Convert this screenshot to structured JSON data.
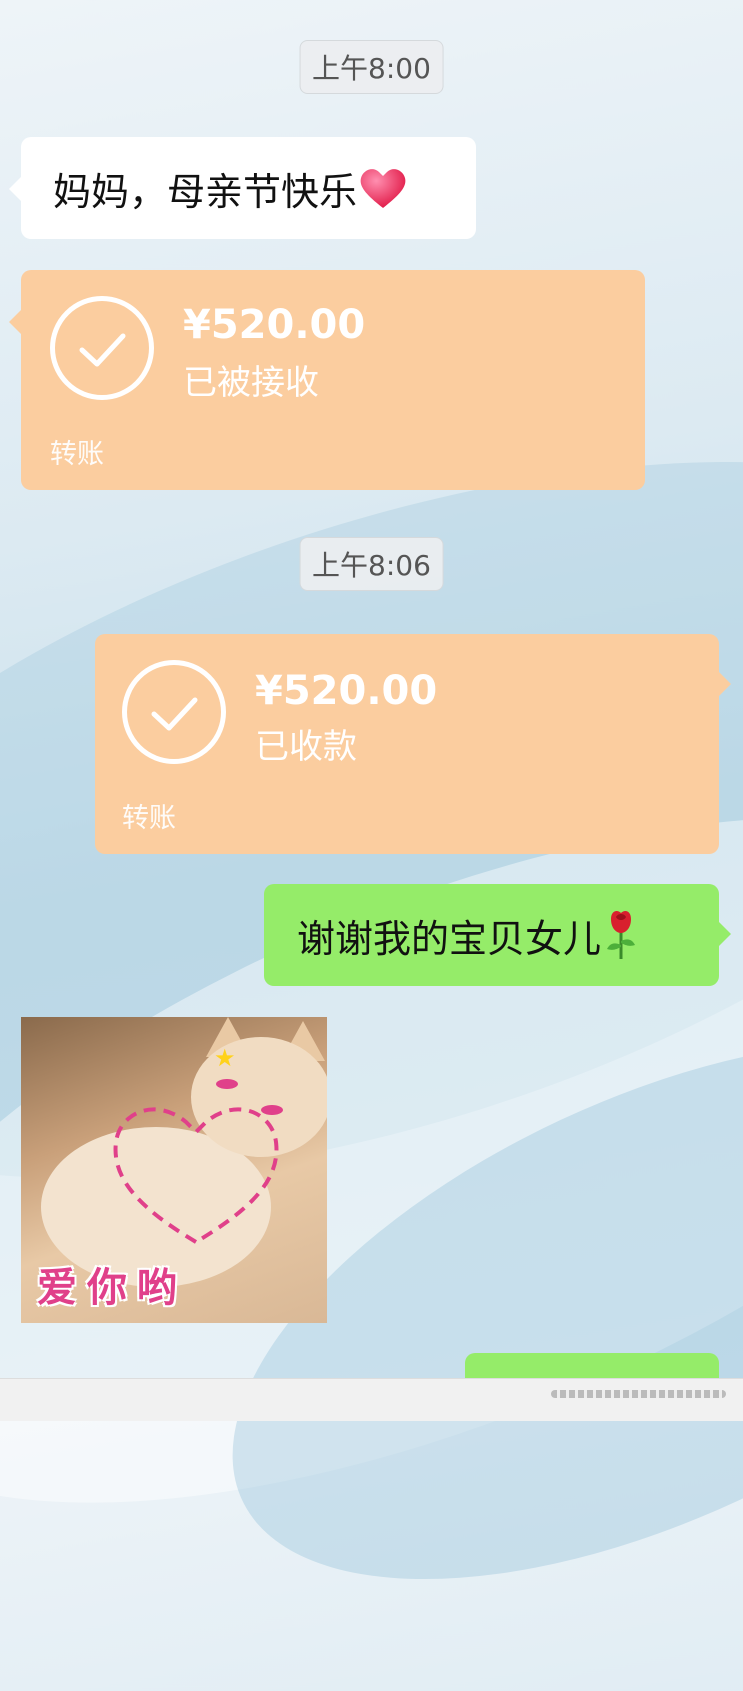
{
  "messages": {
    "time1": "上午8:00",
    "greeting": "妈妈，母亲节快乐",
    "greeting_emoji": "heart",
    "transfer1": {
      "amount": "¥520.00",
      "status": "已被接收",
      "label": "转账"
    },
    "time2": "上午8:06",
    "transfer2": {
      "amount": "¥520.00",
      "status": "已收款",
      "label": "转账"
    },
    "reply": "谢谢我的宝贝女儿",
    "reply_emoji": "rose",
    "sticker_text": "爱你哟"
  },
  "colors": {
    "transfer_orange": "#fbcd9f",
    "sent_green": "#95ec69",
    "received_white": "#ffffff"
  }
}
